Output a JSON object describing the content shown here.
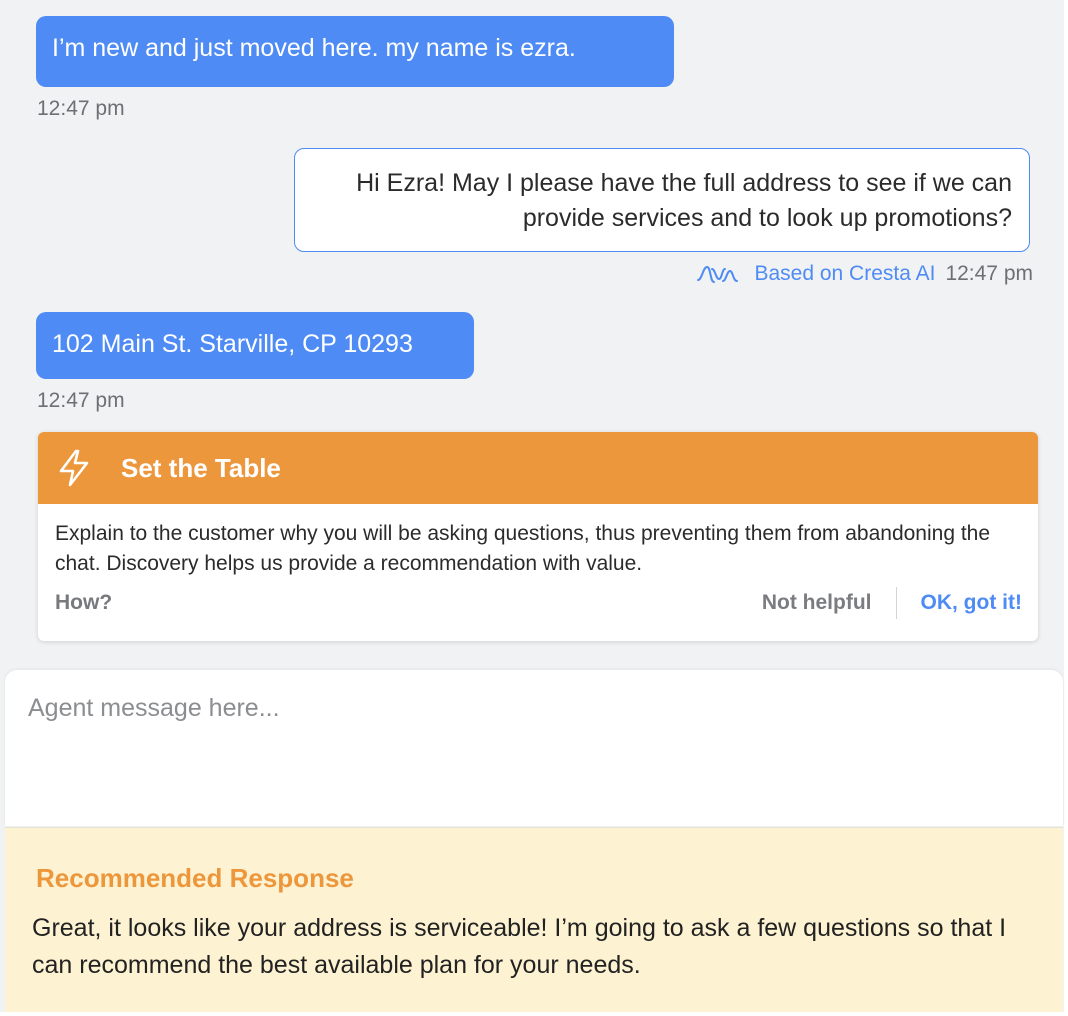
{
  "conversation": {
    "messages": [
      {
        "sender": "customer",
        "text": "I’m new and just moved here. my name is ezra.",
        "time": "12:47 pm"
      },
      {
        "sender": "agent",
        "text": "Hi Ezra! May I please have the full address to see if we can provide services and to look up promotions?",
        "source": "Based on Cresta AI",
        "time": "12:47 pm"
      },
      {
        "sender": "customer",
        "text": "102 Main St. Starville, CP 10293",
        "time": "12:47 pm"
      }
    ]
  },
  "hint_card": {
    "icon": "lightning-bolt-icon",
    "title": "Set the Table",
    "body": "Explain to the customer why you will be asking questions, thus preventing them from abandoning the chat. Discovery helps us provide a recommendation with value.",
    "how_label": "How?",
    "not_helpful_label": "Not helpful",
    "ok_label": "OK, got it!"
  },
  "composer": {
    "placeholder": "Agent message here...",
    "value": ""
  },
  "recommended": {
    "title": "Recommended Response",
    "text": "Great, it looks like your address is serviceable! I’m going to ask a few questions so that I can recommend the best available plan for your needs."
  },
  "colors": {
    "customer_bubble": "#4e8bf5",
    "accent_orange": "#ed973d",
    "link_blue": "#4e8bf5",
    "recommend_bg": "#fdf2d1",
    "page_bg": "#f1f2f4"
  }
}
